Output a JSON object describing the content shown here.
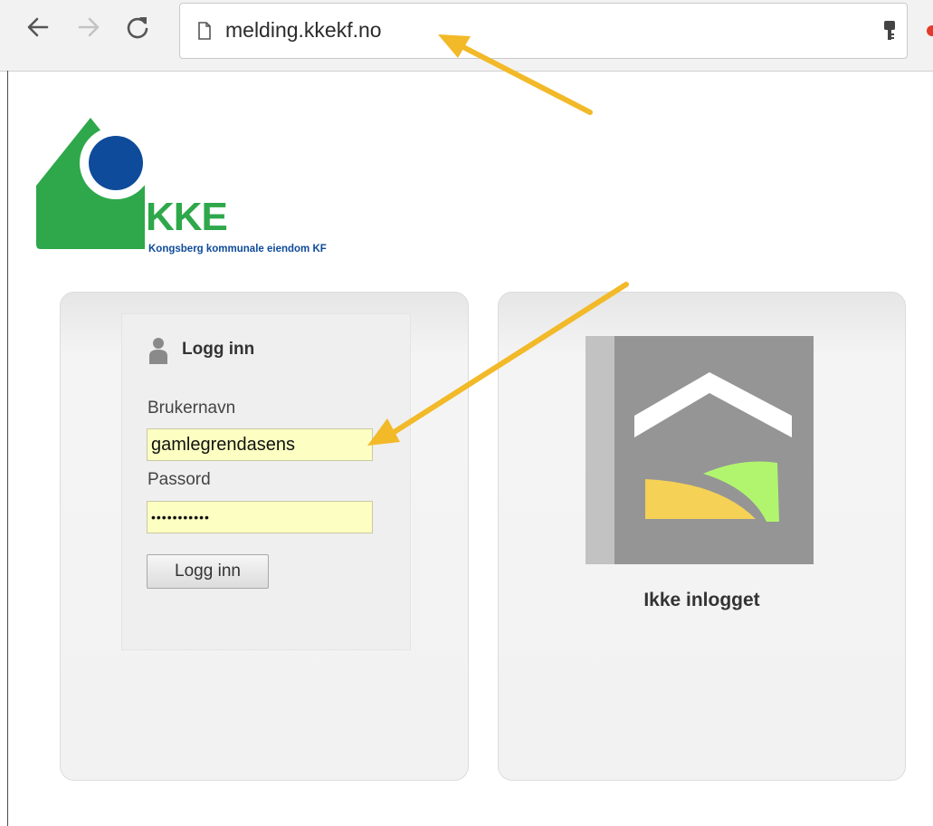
{
  "browser": {
    "url": "melding.kkekf.no",
    "back_icon": "arrow-left-icon",
    "forward_icon": "arrow-right-icon",
    "reload_icon": "reload-icon",
    "page_icon": "page-icon",
    "key_icon": "key-icon"
  },
  "logo": {
    "title": "KKE",
    "subtitle": "Kongsberg kommunale eiendom KF",
    "colors": {
      "green": "#2ea84a",
      "blue": "#0e4b9a"
    }
  },
  "login": {
    "header": "Logg inn",
    "username_label": "Brukernavn",
    "username_value": "gamlegrendasens",
    "password_label": "Passord",
    "password_value": "•••••••••••",
    "button_label": "Logg inn"
  },
  "status": {
    "text": "Ikke inlogget"
  },
  "colors": {
    "input_autofill": "#fcffc1",
    "annotation_arrow": "#f2b928"
  }
}
